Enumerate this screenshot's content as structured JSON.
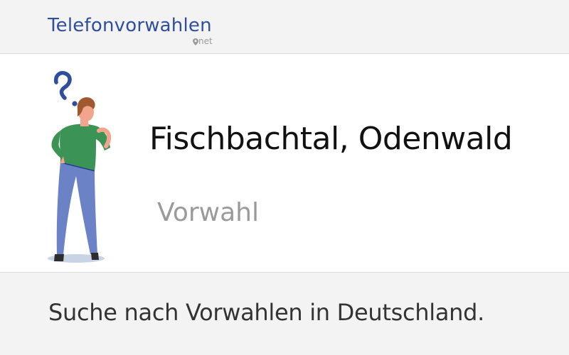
{
  "header": {
    "logo_text": "Telefonvorwahlen",
    "logo_sub": "net",
    "pin_icon": "location-pin-icon",
    "brand_color": "#2f4f9c"
  },
  "hero": {
    "title": "Fischbachtal, Odenwald",
    "subtitle": "Vorwahl",
    "illustration": "person-question-mark-illustration"
  },
  "footer": {
    "text": "Suche nach Vorwahlen in Deutschland."
  }
}
